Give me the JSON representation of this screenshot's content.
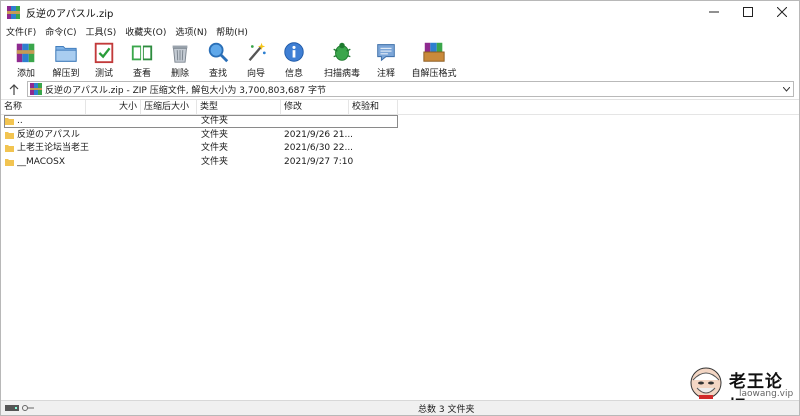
{
  "window": {
    "title": "反逆のアパスル.zip",
    "controls": [
      "minimize-icon",
      "maximize-icon",
      "close-icon"
    ]
  },
  "menu": [
    "文件(F)",
    "命令(C)",
    "工具(S)",
    "收藏夹(O)",
    "选项(N)",
    "帮助(H)"
  ],
  "toolbar": {
    "add": "添加",
    "extract": "解压到",
    "test": "测试",
    "view": "查看",
    "delete": "删除",
    "find": "查找",
    "wizard": "向导",
    "info": "信息",
    "virus": "扫描病毒",
    "comment": "注释",
    "sfx": "自解压格式"
  },
  "address": {
    "text": "反逆のアパスル.zip - ZIP 压缩文件, 解包大小为 3,700,803,687 字节"
  },
  "columns": {
    "name": "名称",
    "size": "大小",
    "packed": "压缩后大小",
    "type": "类型",
    "modified": "修改",
    "crc": "校验和"
  },
  "rows": [
    {
      "name": "..",
      "type": "文件夹",
      "modified": ""
    },
    {
      "name": "反逆のアパスル",
      "type": "文件夹",
      "modified": "2021/9/26 21..."
    },
    {
      "name": "上老王论坛当老王",
      "type": "文件夹",
      "modified": "2021/6/30 22..."
    },
    {
      "name": "__MACOSX",
      "type": "文件夹",
      "modified": "2021/9/27 7:10"
    }
  ],
  "watermark": {
    "brand": "老王论坛",
    "site": "laowang.vip"
  },
  "status": {
    "text": "总数 3 文件夹"
  },
  "colors": {
    "folder": "#f2c451",
    "selection_border": "#8a8a8a",
    "statusbar": "#f0f0f0"
  }
}
